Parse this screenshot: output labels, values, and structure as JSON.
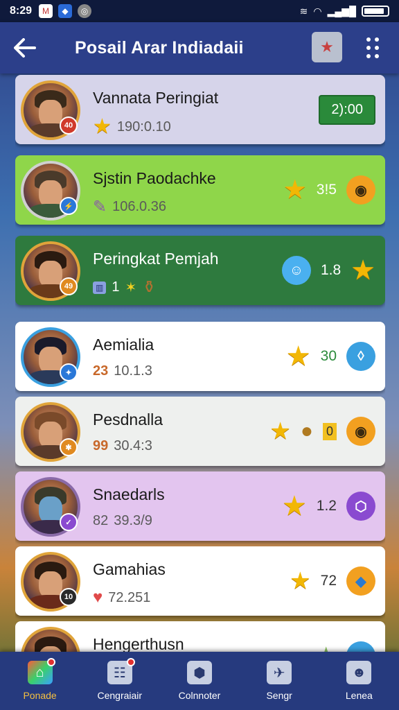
{
  "status_bar": {
    "time": "8:29"
  },
  "app_bar": {
    "title": "Posail Arar Indiadaii"
  },
  "entries": [
    {
      "name": "Vannata Peringiat",
      "sub_value": "190:0.10",
      "timer": "2):00",
      "badge": "40"
    },
    {
      "name": "Sjstin Paodachke",
      "sub_value": "106.0.36",
      "right_value": "3!5",
      "badge": ""
    },
    {
      "name": "Peringkat Pemjah",
      "sub_value": "1",
      "right_value": "1.8",
      "badge": "49"
    },
    {
      "name": "Aemialia",
      "sub_prefix": "23",
      "sub_value": "10.1.3",
      "right_value": "30",
      "badge": ""
    },
    {
      "name": "Pesdnalla",
      "sub_prefix": "99",
      "sub_value": "30.4:3",
      "right_value": "0",
      "badge": ""
    },
    {
      "name": "Snaedarls",
      "sub_prefix": "82",
      "sub_value": "39.3/9",
      "right_value": "1.2",
      "badge": ""
    },
    {
      "name": "Gamahias",
      "sub_value": "72.251",
      "right_value": "72",
      "badge": "10"
    },
    {
      "name": "Hengerthusn",
      "sub_value": "",
      "right_value": "",
      "badge": ""
    }
  ],
  "bottom_nav": [
    {
      "label": "Ponade",
      "icon": "home-icon"
    },
    {
      "label": "Cengraiair",
      "icon": "contacts-icon"
    },
    {
      "label": "Colnnoter",
      "icon": "connect-icon"
    },
    {
      "label": "Sengr",
      "icon": "ship-icon"
    },
    {
      "label": "Lenea",
      "icon": "profile-icon"
    }
  ],
  "colors": {
    "app_bar": "#2c3f8a",
    "card_lavender": "#d6d4ea",
    "card_lime": "#8fd64a",
    "card_dark_green": "#2e7a3e",
    "card_white": "#ffffff",
    "card_light_gray": "#eef0ee",
    "card_pink": "#e3c5ef",
    "accent_gold": "#f5c040"
  }
}
